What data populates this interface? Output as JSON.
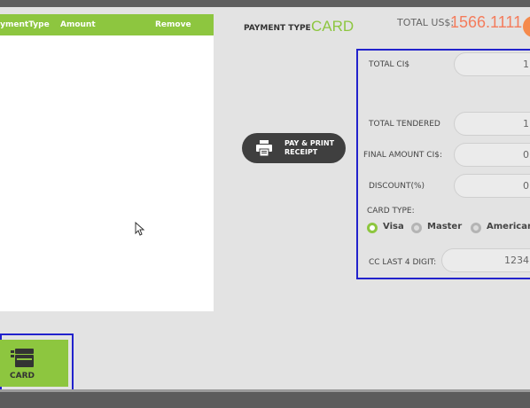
{
  "table": {
    "headers": [
      "PaymentType",
      "Amount",
      "Remove"
    ]
  },
  "payment": {
    "type_label": "PAYMENT TYPE",
    "type_value": "CARD",
    "total_us_label": "TOTAL US$:",
    "total_us_value": "1566.1111"
  },
  "print_button": {
    "line1": "PAY & PRINT",
    "line2": "RECEIPT"
  },
  "form": {
    "total_ci_label": "TOTAL CI$",
    "total_ci_value": "1",
    "total_tendered_label": "TOTAL TENDERED",
    "total_tendered_value": "1",
    "final_amount_label": "FINAL AMOUNT CI$:",
    "final_amount_value": "0",
    "discount_label": "DISCOUNT(%)",
    "discount_value": "0",
    "card_type_label": "CARD TYPE:",
    "card_types": [
      "Visa",
      "Master",
      "American"
    ],
    "card_type_selected": "Visa",
    "cc_last4_label": "CC LAST 4 DIGIT:",
    "cc_last4_value": "1234"
  },
  "card_button": {
    "label": "CARD",
    "icon": "credit-card-icon"
  },
  "colors": {
    "accent_green": "#8dc63f",
    "total_orange": "#f47c5c",
    "highlight_blue": "#2222cc"
  }
}
